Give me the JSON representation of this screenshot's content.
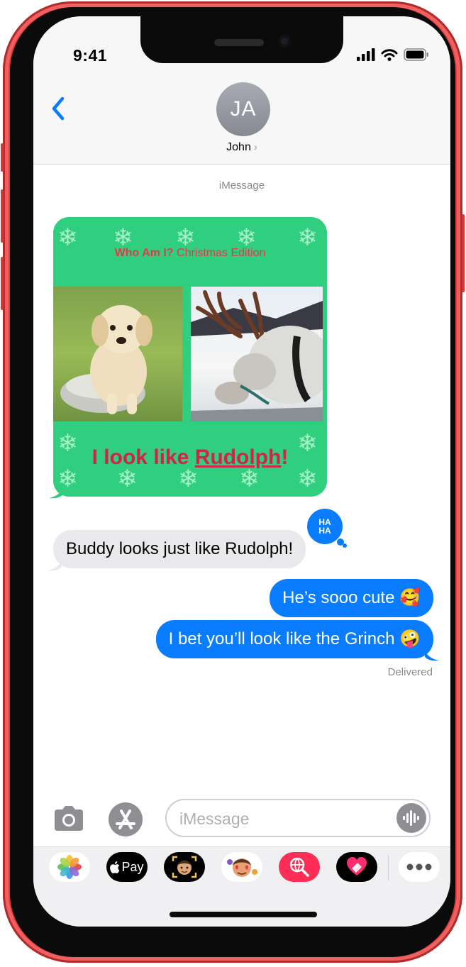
{
  "status_bar": {
    "time": "9:41"
  },
  "header": {
    "avatar_initials": "JA",
    "contact_name": "John",
    "contact_chevron": "›"
  },
  "conversation": {
    "service_label": "iMessage",
    "card": {
      "title_bold": "Who Am I?",
      "title_rest": " Christmas Edition",
      "caption_prefix": "I look like ",
      "caption_link": "Rudolph",
      "caption_suffix": "!"
    },
    "tapback": {
      "line1": "HA",
      "line2": "HA"
    },
    "messages": [
      {
        "direction": "incoming",
        "text": "Buddy looks just like Rudolph!"
      },
      {
        "direction": "outgoing",
        "text": "He’s sooo cute 🥰"
      },
      {
        "direction": "outgoing",
        "text": "I bet you’ll look like the Grinch 🤪"
      }
    ],
    "delivery_status": "Delivered"
  },
  "composer": {
    "placeholder": "iMessage"
  },
  "app_drawer": {
    "items": [
      {
        "name": "photos-app",
        "icon": "photos-icon"
      },
      {
        "name": "apple-pay-app",
        "label": "Pay",
        "icon": "apple-logo-icon"
      },
      {
        "name": "memoji-app",
        "icon": "memoji-icon"
      },
      {
        "name": "memoji-stickers-app",
        "icon": "memoji-stickers-icon"
      },
      {
        "name": "image-search-app",
        "icon": "globe-search-icon"
      },
      {
        "name": "digital-touch-app",
        "icon": "heart-touch-icon"
      },
      {
        "name": "more-apps",
        "icon": "more-icon"
      }
    ]
  },
  "colors": {
    "accent": "#0a7cff",
    "incoming_bubble": "#e9e9eb",
    "card_green": "#2fcf7f",
    "card_red": "#d2234a",
    "phone_red": "#e23b3b"
  }
}
